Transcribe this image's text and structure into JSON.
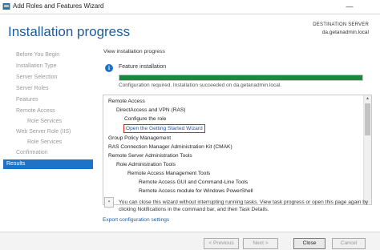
{
  "window": {
    "title": "Add Roles and Features Wizard",
    "minimize_glyph": "—"
  },
  "header": {
    "page_title": "Installation progress",
    "destination_label": "DESTINATION SERVER",
    "destination_value": "da.getanadmin.local"
  },
  "nav": {
    "items": [
      {
        "label": "Before You Begin",
        "active": false
      },
      {
        "label": "Installation Type",
        "active": false
      },
      {
        "label": "Server Selection",
        "active": false
      },
      {
        "label": "Server Roles",
        "active": false
      },
      {
        "label": "Features",
        "active": false
      },
      {
        "label": "Remote Access",
        "active": false
      },
      {
        "label": "Role Services",
        "active": false
      },
      {
        "label": "Web Server Role (IIS)",
        "active": false
      },
      {
        "label": "Role Services",
        "active": false
      },
      {
        "label": "Confirmation",
        "active": false
      },
      {
        "label": "Results",
        "active": true
      }
    ]
  },
  "main": {
    "view_label": "View installation progress",
    "info_icon_glyph": "i",
    "feature_title": "Feature installation",
    "progress_fraction": 1.0,
    "status_text": "Configuration required. Installation succeeded on da.getanadmin.local.",
    "results": [
      "Remote Access",
      "DirectAccess and VPN (RAS)",
      "Configure the role",
      "Open the Getting Started Wizard",
      "Group Policy Management",
      "RAS Connection Manager Administration Kit (CMAK)",
      "Remote Server Administration Tools",
      "Role Administration Tools",
      "Remote Access Management Tools",
      "Remote Access GUI and Command-Line Tools",
      "Remote Access module for Windows PowerShell"
    ],
    "close_note": "You can close this wizard without interrupting running tasks. View task progress or open this page again by clicking Notifications in the command bar, and then Task Details.",
    "export_link": "Export configuration settings"
  },
  "footer": {
    "previous_label": "< Previous",
    "next_label": "Next >",
    "close_label": "Close",
    "cancel_label": "Cancel"
  },
  "colors": {
    "accent": "#1e73c6",
    "title_blue": "#1e5a9c",
    "progress_green": "#1b8a3e",
    "highlight_red": "#e02020"
  }
}
